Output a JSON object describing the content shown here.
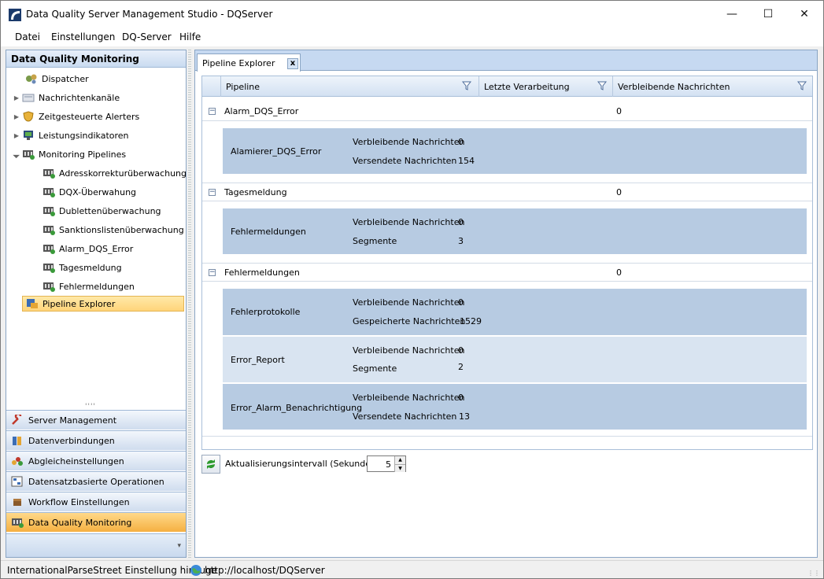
{
  "window": {
    "title": "Data Quality Server Management Studio - DQServer"
  },
  "menu": [
    "Datei",
    "Einstellungen",
    "DQ-Server",
    "Hilfe"
  ],
  "left": {
    "header": "Data Quality Monitoring",
    "tree": [
      {
        "label": "Dispatcher",
        "icon": "dispatcher-icon"
      },
      {
        "label": "Nachrichtenkanäle",
        "icon": "channels-icon"
      },
      {
        "label": "Zeitgesteuerte Alerters",
        "icon": "shield-icon"
      },
      {
        "label": "Leistungsindikatoren",
        "icon": "monitor-icon"
      },
      {
        "label": "Monitoring Pipelines",
        "icon": "pipeline-icon"
      },
      {
        "label": "Adresskorrekturüberwachung",
        "icon": "pipeline-icon"
      },
      {
        "label": "DQX-Überwahung",
        "icon": "pipeline-icon"
      },
      {
        "label": "Dublettenüberwachung",
        "icon": "pipeline-icon"
      },
      {
        "label": "Sanktionslistenüberwachung",
        "icon": "pipeline-icon"
      },
      {
        "label": "Alarm_DQS_Error",
        "icon": "pipeline-icon"
      },
      {
        "label": "Tagesmeldung",
        "icon": "pipeline-icon"
      },
      {
        "label": "Fehlermeldungen",
        "icon": "pipeline-icon"
      },
      {
        "label": "Pipeline Explorer",
        "icon": "explorer-icon"
      }
    ],
    "nav": [
      {
        "label": "Server Management",
        "icon": "wrench-icon"
      },
      {
        "label": "Datenverbindungen",
        "icon": "database-icon"
      },
      {
        "label": "Abgleicheinstellungen",
        "icon": "balls-icon"
      },
      {
        "label": "Datensatzbasierte Operationen",
        "icon": "records-icon"
      },
      {
        "label": "Workflow Einstellungen",
        "icon": "box-icon"
      },
      {
        "label": "Data Quality Monitoring",
        "icon": "pipeline-icon"
      }
    ]
  },
  "tab": {
    "label": "Pipeline Explorer",
    "close": "x"
  },
  "grid": {
    "columns": [
      "Pipeline",
      "Letzte Verarbeitung",
      "Verbleibende Nachrichten"
    ],
    "groups": [
      {
        "name": "Alarm_DQS_Error",
        "value": "0",
        "expander": "−",
        "details": [
          {
            "name": "Alamierer_DQS_Error",
            "rows": [
              {
                "label": "Verbleibende Nachrichten",
                "value": "0"
              },
              {
                "label": "Versendete Nachrichten",
                "value": "154"
              }
            ]
          }
        ]
      },
      {
        "name": "Tagesmeldung",
        "value": "0",
        "expander": "−",
        "details": [
          {
            "name": "Fehlermeldungen",
            "rows": [
              {
                "label": "Verbleibende Nachrichten",
                "value": "0"
              },
              {
                "label": "Segmente",
                "value": "3"
              }
            ]
          }
        ]
      },
      {
        "name": "Fehlermeldungen",
        "value": "0",
        "expander": "−",
        "details": [
          {
            "name": "Fehlerprotokolle",
            "rows": [
              {
                "label": "Verbleibende Nachrichten",
                "value": "0"
              },
              {
                "label": "Gespeicherte Nachrichten",
                "value": "1529"
              }
            ]
          },
          {
            "name": "Error_Report",
            "rows": [
              {
                "label": "Verbleibende Nachrichten",
                "value": "0"
              },
              {
                "label": "Segmente",
                "value": "2"
              }
            ]
          },
          {
            "name": "Error_Alarm_Benachrichtigung",
            "rows": [
              {
                "label": "Verbleibende Nachrichten",
                "value": "0"
              },
              {
                "label": "Versendete Nachrichten",
                "value": "13"
              }
            ]
          }
        ]
      }
    ]
  },
  "refresh": {
    "label": "Aktualisierungsintervall (Sekunden):",
    "value": "5"
  },
  "status": {
    "left": "InternationalParseStreet Einstellung hinzuge",
    "url": "http://localhost/DQServer"
  }
}
